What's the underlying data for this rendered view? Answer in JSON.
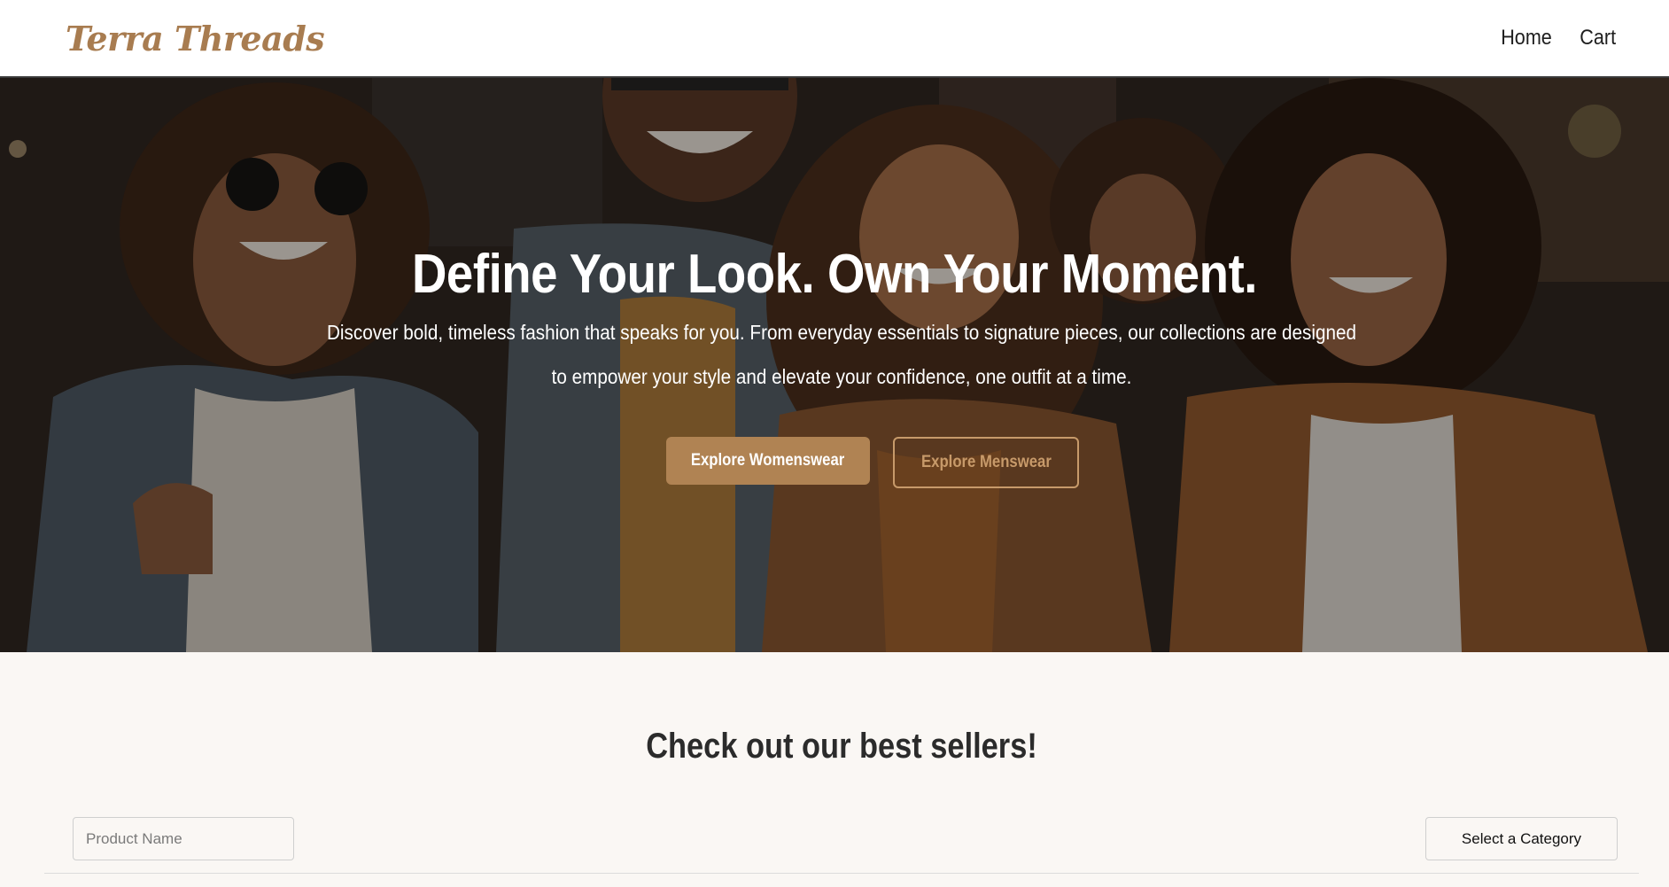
{
  "header": {
    "logo": "Terra Threads",
    "nav": [
      {
        "label": "Home"
      },
      {
        "label": "Cart"
      }
    ]
  },
  "hero": {
    "title": "Define Your Look. Own Your Moment.",
    "subtitle": "Discover bold, timeless fashion that speaks for you. From everyday essentials to signature pieces, our collections are designed to empower your style and elevate your confidence, one outfit at a time.",
    "primary_button": "Explore Womenswear",
    "secondary_button": "Explore Menswear"
  },
  "bestsellers": {
    "title": "Check out our best sellers!",
    "search_placeholder": "Product Name",
    "category_label": "Select a Category"
  },
  "colors": {
    "brand": "#a87c50",
    "primary_button": "#b08353",
    "outline_button": "#c79a6a",
    "page_background": "#faf7f4"
  }
}
